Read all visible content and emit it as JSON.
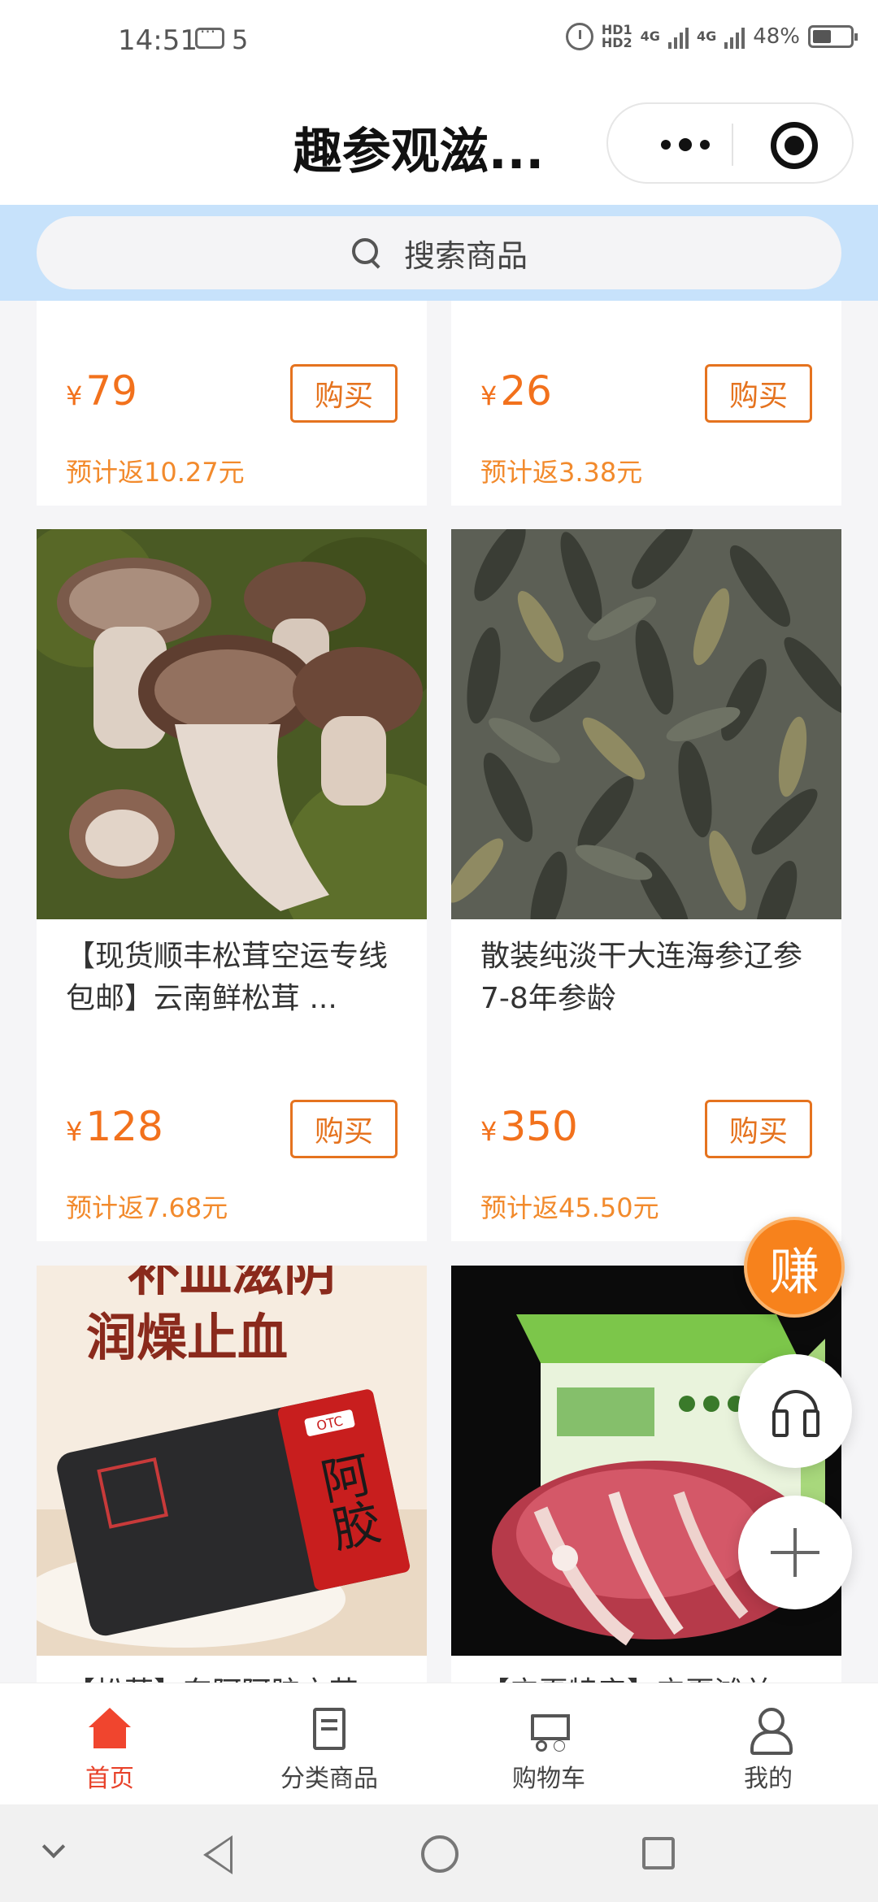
{
  "status_bar": {
    "time": "14:51",
    "notif_count": "5",
    "net1": "HD1",
    "net2": "HD2",
    "gen1": "4G",
    "gen2": "4G",
    "battery": "48%"
  },
  "header": {
    "title": "趣参观滋..."
  },
  "search": {
    "placeholder": "搜索商品"
  },
  "buy_label": "购买",
  "products": [
    {
      "name": "",
      "price": "79",
      "rebate": "预计返10.27元"
    },
    {
      "name": "",
      "price": "26",
      "rebate": "预计返3.38元"
    },
    {
      "name": "【现货顺丰松茸空运专线包邮】云南鲜松茸 ...",
      "price": "128",
      "rebate": "预计返7.68元",
      "image": "matsutake-mushroom-photo"
    },
    {
      "name": "散装纯淡干大连海参辽参7-8年参龄",
      "price": "350",
      "rebate": "预计返45.50元",
      "image": "dried-sea-cucumber-photo"
    },
    {
      "name": "【松茸】东阿阿胶亦艺",
      "image": "ejiao-gift-box-photo",
      "img_text_1": "补血滋阴",
      "img_text_2": "润燥止血",
      "img_box_brand": "阿胶",
      "img_badge": "OTC"
    },
    {
      "name": "【宁夏特产】宁夏滩羊",
      "image": "lamb-meat-box-photo"
    }
  ],
  "currency": "¥",
  "fab": {
    "earn": "赚"
  },
  "tabs": [
    {
      "label": "首页",
      "active": true,
      "icon": "home-icon"
    },
    {
      "label": "分类商品",
      "icon": "category-icon"
    },
    {
      "label": "购物车",
      "icon": "cart-icon"
    },
    {
      "label": "我的",
      "icon": "profile-icon"
    }
  ],
  "colors": {
    "accent": "#f2711c",
    "tab_active": "#e8432b",
    "search_band": "#c7e2fb"
  }
}
